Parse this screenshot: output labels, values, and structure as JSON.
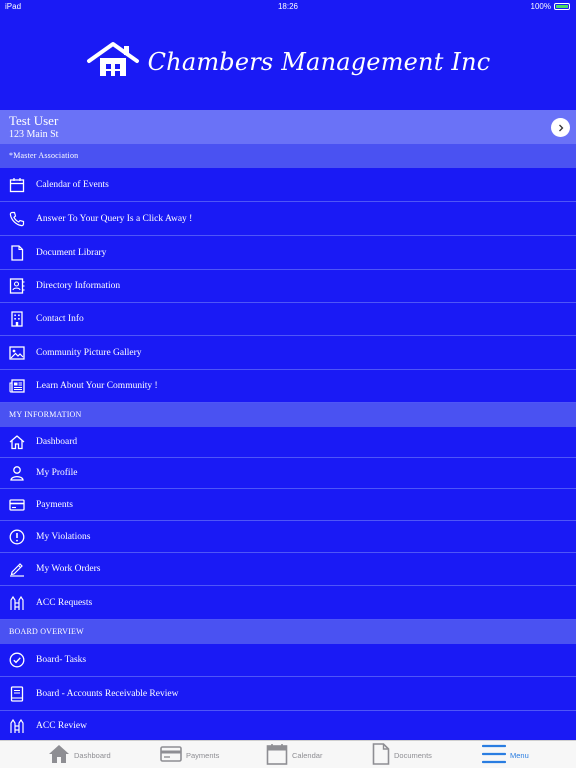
{
  "status_bar": {
    "device": "iPad",
    "time": "18:26",
    "battery": "100%"
  },
  "header": {
    "company_name": "Chambers Management Inc"
  },
  "user": {
    "name": "Test User",
    "address": "123 Main St"
  },
  "sections": {
    "master": "*Master Association",
    "my_info": "MY INFORMATION",
    "board": "BOARD OVERVIEW"
  },
  "master_items": [
    {
      "label": "Calendar of Events",
      "icon": "calendar-icon"
    },
    {
      "label": "Answer To Your Query Is a Click Away !",
      "icon": "phone-icon"
    },
    {
      "label": "Document Library",
      "icon": "document-icon"
    },
    {
      "label": "Directory Information",
      "icon": "contact-card-icon"
    },
    {
      "label": "Contact Info",
      "icon": "building-icon"
    },
    {
      "label": "Community Picture Gallery",
      "icon": "image-icon"
    },
    {
      "label": "Learn About Your Community !",
      "icon": "newspaper-icon"
    }
  ],
  "my_info_items": [
    {
      "label": "Dashboard",
      "icon": "home-icon"
    },
    {
      "label": "My Profile",
      "icon": "user-icon"
    },
    {
      "label": "Payments",
      "icon": "credit-card-icon"
    },
    {
      "label": "My Violations",
      "icon": "alert-icon"
    },
    {
      "label": "My Work Orders",
      "icon": "pencil-icon"
    },
    {
      "label": "ACC Requests",
      "icon": "acc-icon"
    }
  ],
  "board_items": [
    {
      "label": "Board- Tasks",
      "icon": "check-circle-icon"
    },
    {
      "label": "Board - Accounts Receivable Review",
      "icon": "book-icon"
    },
    {
      "label": "ACC Review",
      "icon": "acc-icon"
    }
  ],
  "tabs": [
    {
      "label": "Dashboard",
      "icon": "home-icon"
    },
    {
      "label": "Payments",
      "icon": "credit-card-icon"
    },
    {
      "label": "Calendar",
      "icon": "calendar-icon"
    },
    {
      "label": "Documents",
      "icon": "document-icon"
    },
    {
      "label": "Menu",
      "icon": "menu-icon"
    }
  ],
  "colors": {
    "background": "#1a1af5",
    "user_card": "#6a72f7",
    "section_header": "#4a52f2",
    "tab_active": "#2a7de1",
    "tab_inactive": "#8e8e93"
  }
}
